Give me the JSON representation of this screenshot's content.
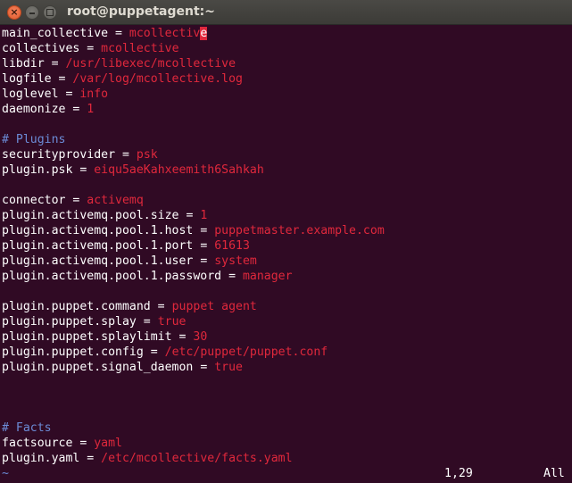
{
  "window": {
    "title": "root@puppetagent:~",
    "close_glyph": "×",
    "background": "#300a24"
  },
  "lines": [
    {
      "key": "main_collective",
      "eq": " = ",
      "val": "mcollectiv",
      "cursor_char": "e"
    },
    {
      "key": "collectives",
      "eq": " = ",
      "val": "mcollective"
    },
    {
      "key": "libdir",
      "eq": " = ",
      "val": "/usr/libexec/mcollective"
    },
    {
      "key": "logfile",
      "eq": " = ",
      "val": "/var/log/mcollective.log"
    },
    {
      "key": "loglevel",
      "eq": " = ",
      "val": "info"
    },
    {
      "key": "daemonize",
      "eq": " = ",
      "val": "1"
    },
    {
      "blank": true
    },
    {
      "comment": "# Plugins"
    },
    {
      "key": "securityprovider",
      "eq": " = ",
      "val": "psk"
    },
    {
      "key": "plugin.psk",
      "eq": " = ",
      "val": "eiqu5aeKahxeemith6Sahkah"
    },
    {
      "blank": true
    },
    {
      "key": "connector",
      "eq": " = ",
      "val": "activemq"
    },
    {
      "key": "plugin.activemq.pool.size",
      "eq": " = ",
      "val": "1"
    },
    {
      "key": "plugin.activemq.pool.1.host",
      "eq": " = ",
      "val": "puppetmaster.example.com"
    },
    {
      "key": "plugin.activemq.pool.1.port",
      "eq": " = ",
      "val": "61613"
    },
    {
      "key": "plugin.activemq.pool.1.user",
      "eq": " = ",
      "val": "system"
    },
    {
      "key": "plugin.activemq.pool.1.password",
      "eq": " = ",
      "val": "manager"
    },
    {
      "blank": true
    },
    {
      "key": "plugin.puppet.command",
      "eq": " = ",
      "val": "puppet agent"
    },
    {
      "key": "plugin.puppet.splay",
      "eq": " = ",
      "val": "true"
    },
    {
      "key": "plugin.puppet.splaylimit",
      "eq": " = ",
      "val": "30"
    },
    {
      "key": "plugin.puppet.config",
      "eq": " = ",
      "val": "/etc/puppet/puppet.conf"
    },
    {
      "key": "plugin.puppet.signal_daemon",
      "eq": " = ",
      "val": "true"
    },
    {
      "blank": true
    },
    {
      "blank": true
    },
    {
      "blank": true
    },
    {
      "comment": "# Facts"
    },
    {
      "key": "factsource",
      "eq": " = ",
      "val": "yaml"
    },
    {
      "key": "plugin.yaml",
      "eq": " = ",
      "val": "/etc/mcollective/facts.yaml"
    },
    {
      "tilde": "~"
    }
  ],
  "status": {
    "position": "1,29",
    "scroll": "All"
  },
  "colors": {
    "value": "#e0283c",
    "comment": "#6b8bd6",
    "text": "#ffffff"
  }
}
